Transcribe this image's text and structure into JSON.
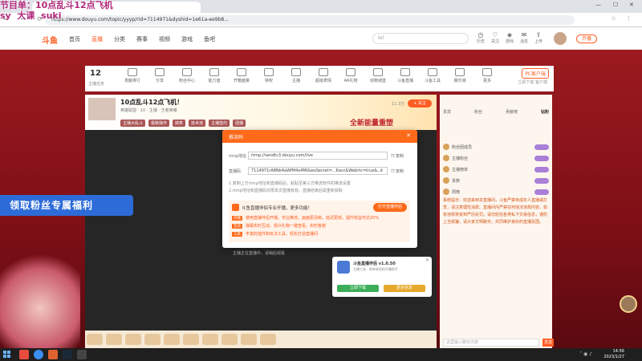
{
  "browser": {
    "tab_title": "",
    "url": "https://www.douyu.com/topic/yyyp/rid=7114971&dyshid=1e61a-ee9b8...",
    "controls": [
      "—",
      "☐",
      "✕"
    ]
  },
  "overlay": {
    "line1": "节目单：10点乱斗12点飞机",
    "line2": "sy  大课  suki"
  },
  "site": {
    "logo": "斗鱼",
    "nav": [
      {
        "label": "首页"
      },
      {
        "label": "直播"
      },
      {
        "label": "分类"
      },
      {
        "label": "赛事"
      },
      {
        "label": "视频"
      },
      {
        "label": "游戏"
      },
      {
        "label": "鱼吧"
      }
    ],
    "search_placeholder": "lol",
    "icons": [
      {
        "icon": "history-icon",
        "label": "历史"
      },
      {
        "icon": "follow-icon",
        "label": "关注"
      },
      {
        "icon": "game-icon",
        "label": "游戏"
      },
      {
        "icon": "bell-icon",
        "label": "消息"
      },
      {
        "icon": "upload-icon",
        "label": "上传"
      }
    ],
    "live_btn": "开播"
  },
  "toolbar": {
    "count": "12",
    "count_label": "主播任务",
    "items": [
      "贡献排行",
      "分享",
      "粉丝中心",
      "能力值",
      "开箱盛宴",
      "特权",
      "主播",
      "超级表情",
      "AR礼物",
      "动物城堡",
      "斗鱼直播",
      "斗鱼工具",
      "娱乐城",
      "更多"
    ],
    "pc_label": "PC客户端",
    "pc_sub": "立即下载 客户端"
  },
  "room": {
    "title": "10点乱斗12点飞机！",
    "meta": "英雄联盟 · 10 · 主播 · 王者荣耀",
    "tags": [
      "主播大乱斗",
      "极致操作",
      "搞笑",
      "技术流",
      "主播签约",
      "团播"
    ],
    "banner": "全新能量重塑",
    "fans": "11.3万",
    "follow": "+ 关注"
  },
  "modal": {
    "title": "推流码",
    "rtmp_label": "rtmp地址",
    "rtmp_value": "rtmp://sendtc3.douyu.com/live",
    "key_label": "直播码",
    "key_value": "7114971rA8Nb4aWfM4x4Ml&wsSecret=...6acc&Webrtc=true&..d",
    "copy": "复制",
    "close": "✕",
    "note1": "1.复制上方rtmp地址和直播码后，粘贴至第三方推流软件的推流设置",
    "note2": "2.rtmp地址和直播码仅限本次直播有效，直播结束后需重新获取",
    "tip_title": "斗鱼直播伴侣专业开播，更多功能！",
    "tip_btn": "打开直播伴侣",
    "tips": [
      {
        "tag": "开播",
        "text": "使用直播伴侣开播，专业推流，画面更清晰，延迟更低，提升收益可达20%"
      },
      {
        "tag": "互动",
        "text": "弹幕实时互动，观众礼物一键查看，实时答谢"
      },
      {
        "tag": "工具",
        "text": "丰富的插件和玩法工具，轻松打造直播间"
      }
    ]
  },
  "video_caption": "主播正在直播中，请稍后观看",
  "promo": "领取粉丝专属福利",
  "side": {
    "tabs": [
      "贵宾",
      "粉丝",
      "贡献榜",
      "钻粉"
    ],
    "rank": [
      "粉丝团成员",
      "主播粉丝",
      "主播榜单",
      "贵族",
      "周榜"
    ],
    "chat": "系统提示：欢迎来到本直播间，斗鱼严禁未成年人直播或打赏，请注意理性消费。直播间内严禁任何违法违规内容，如有违规将受到严厉处罚。请勿轻信各类私下交易信息，谨防上当受骗，请大家文明聊天，共同维护良好的直播氛围。",
    "input_placeholder": "这里输入聊天内容",
    "send": "发送"
  },
  "download": {
    "name": "斗鱼直播伴侣 v1.0.50",
    "desc": "主播工具 · 简单易用的开播助手",
    "b1": "立即下载",
    "b2": "更多信息",
    "close": "✕"
  },
  "clock": {
    "time": "14:56",
    "date": "2023/1/27"
  }
}
